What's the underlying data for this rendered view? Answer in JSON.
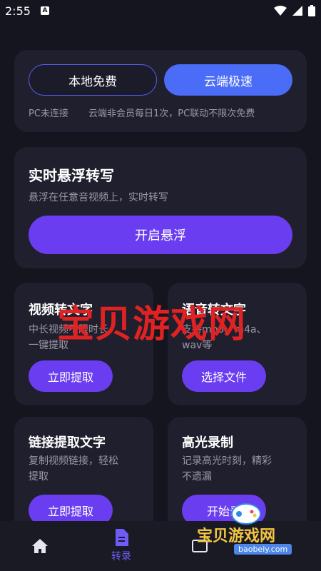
{
  "status_bar": {
    "time": "2:55",
    "a_icon": "A"
  },
  "mode_card": {
    "local_label": "本地免费",
    "cloud_label": "云端极速",
    "pc_status": "PC未连接",
    "cloud_note": "云端非会员每日1次，PC联动不限次免费"
  },
  "float_card": {
    "title": "实时悬浮转写",
    "subtitle": "悬浮在任意音视频上，实时转写",
    "button": "开启悬浮"
  },
  "video_card": {
    "title": "视频转文字",
    "desc": "中长视频不限时长，一键提取",
    "button": "立即提取"
  },
  "audio_card": {
    "title": "语音转文字",
    "desc": "支持mp3、m4a、wav等",
    "button": "选择文件"
  },
  "link_card": {
    "title": "链接提取文字",
    "desc": "复制视频链接，轻松提取",
    "button": "立即提取"
  },
  "highlight_card": {
    "title": "高光录制",
    "desc": "记录高光时刻，精彩不遗漏",
    "button": "开始录"
  },
  "bottom_nav": {
    "transcribe_label": "转录"
  },
  "watermark": {
    "big": "宝贝游戏网",
    "small": "宝贝游戏网",
    "domain": "baobeiy.com"
  },
  "colors": {
    "accent": "#6a3df0",
    "cloud_blue": "#4a6cf7",
    "bg": "#15151f",
    "card": "#1f1f2d"
  }
}
